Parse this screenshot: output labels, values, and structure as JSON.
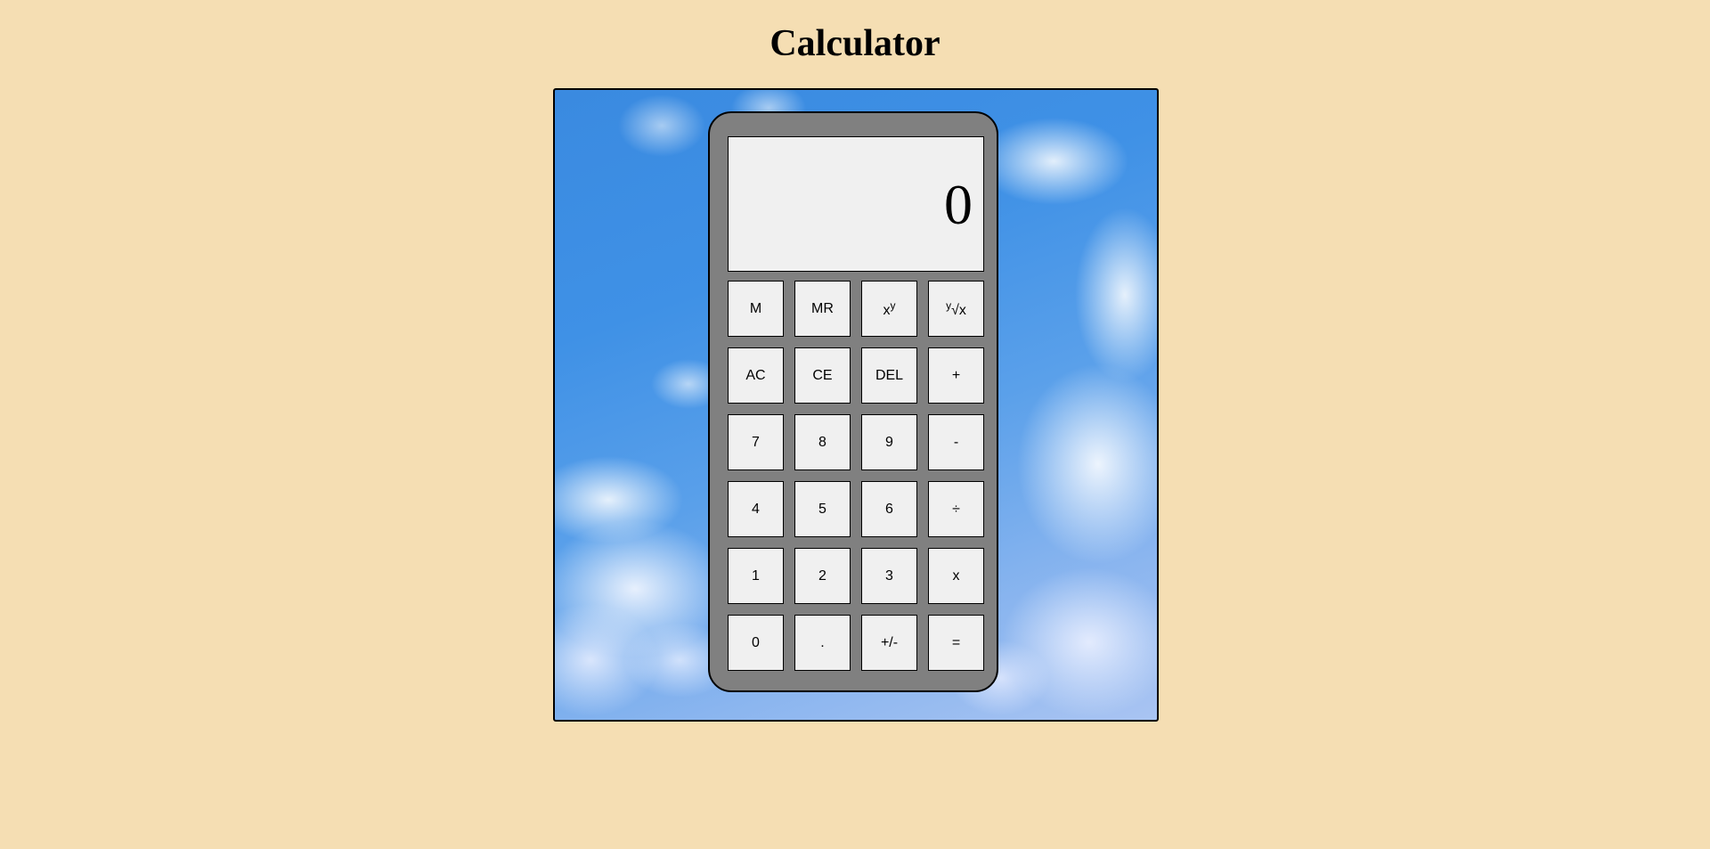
{
  "page": {
    "title": "Calculator"
  },
  "display": {
    "value": "0"
  },
  "keys": {
    "memory_store": "M",
    "memory_recall": "MR",
    "power_base": "x",
    "power_exp": "y",
    "root_index": "y",
    "root_sign": "√x",
    "all_clear": "AC",
    "clear_entry": "CE",
    "delete": "DEL",
    "add": "+",
    "seven": "7",
    "eight": "8",
    "nine": "9",
    "subtract": "-",
    "four": "4",
    "five": "5",
    "six": "6",
    "divide": "÷",
    "one": "1",
    "two": "2",
    "three": "3",
    "multiply": "x",
    "zero": "0",
    "decimal": ".",
    "negate": "+/-",
    "equals": "="
  },
  "colors": {
    "page_background": "#f5deb3",
    "calculator_body": "#808080",
    "key_background": "#f0f0f0",
    "display_background": "#f0f0f0"
  }
}
